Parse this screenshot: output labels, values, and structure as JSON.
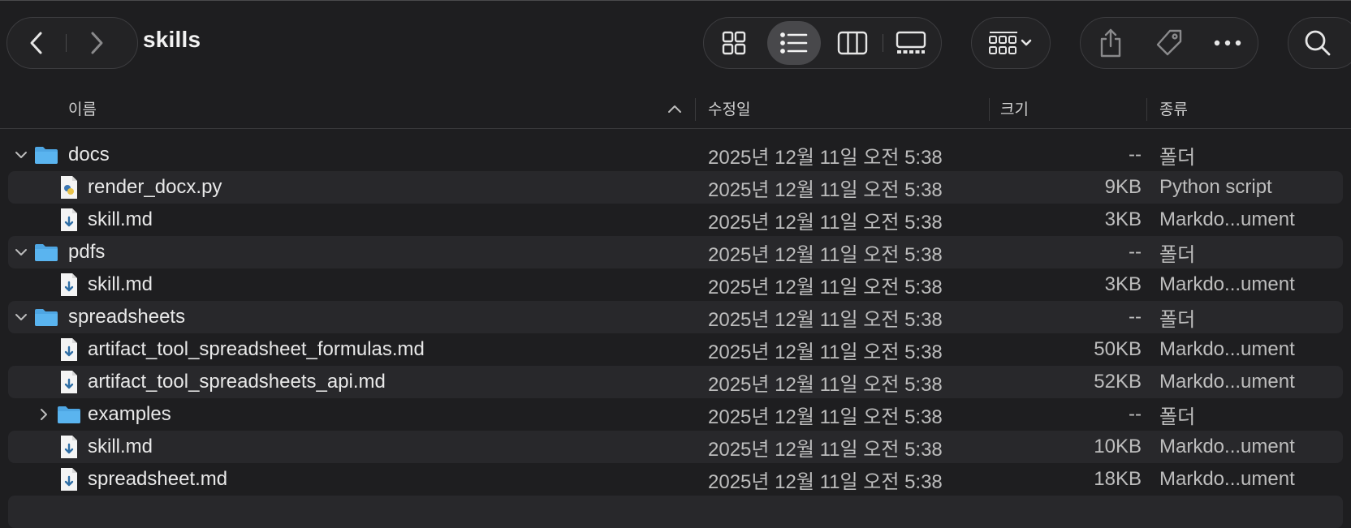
{
  "window": {
    "title": "skills"
  },
  "toolbar": {
    "nav": {
      "back_icon": "chevron-left-icon",
      "forward_icon": "chevron-right-icon"
    },
    "views": [
      {
        "name": "icon-view",
        "icon": "grid-icon",
        "active": false
      },
      {
        "name": "list-view",
        "icon": "list-icon",
        "active": true
      },
      {
        "name": "column-view",
        "icon": "columns-icon",
        "active": false
      },
      {
        "name": "gallery-view",
        "icon": "gallery-icon",
        "active": false
      }
    ],
    "group_icon": "group-by-icon",
    "actions": [
      "share-icon",
      "tag-icon",
      "more-icon"
    ],
    "search_icon": "search-icon"
  },
  "columns": {
    "name": "이름",
    "date": "수정일",
    "size": "크기",
    "kind": "종류"
  },
  "rows": [
    {
      "name": "docs",
      "date": "2025년 12월 11일 오전 5:38",
      "size": "--",
      "kind": "폴더",
      "type": "folder",
      "level": 0,
      "expanded": true
    },
    {
      "name": "render_docx.py",
      "date": "2025년 12월 11일 오전 5:38",
      "size": "9KB",
      "kind": "Python script",
      "type": "python",
      "level": 1
    },
    {
      "name": "skill.md",
      "date": "2025년 12월 11일 오전 5:38",
      "size": "3KB",
      "kind": "Markdo...ument",
      "type": "markdown",
      "level": 1
    },
    {
      "name": "pdfs",
      "date": "2025년 12월 11일 오전 5:38",
      "size": "--",
      "kind": "폴더",
      "type": "folder",
      "level": 0,
      "expanded": true
    },
    {
      "name": "skill.md",
      "date": "2025년 12월 11일 오전 5:38",
      "size": "3KB",
      "kind": "Markdo...ument",
      "type": "markdown",
      "level": 1
    },
    {
      "name": "spreadsheets",
      "date": "2025년 12월 11일 오전 5:38",
      "size": "--",
      "kind": "폴더",
      "type": "folder",
      "level": 0,
      "expanded": true
    },
    {
      "name": "artifact_tool_spreadsheet_formulas.md",
      "date": "2025년 12월 11일 오전 5:38",
      "size": "50KB",
      "kind": "Markdo...ument",
      "type": "markdown",
      "level": 1
    },
    {
      "name": "artifact_tool_spreadsheets_api.md",
      "date": "2025년 12월 11일 오전 5:38",
      "size": "52KB",
      "kind": "Markdo...ument",
      "type": "markdown",
      "level": 1
    },
    {
      "name": "examples",
      "date": "2025년 12월 11일 오전 5:38",
      "size": "--",
      "kind": "폴더",
      "type": "folder",
      "level": 1,
      "expanded": false
    },
    {
      "name": "skill.md",
      "date": "2025년 12월 11일 오전 5:38",
      "size": "10KB",
      "kind": "Markdo...ument",
      "type": "markdown",
      "level": 1
    },
    {
      "name": "spreadsheet.md",
      "date": "2025년 12월 11일 오전 5:38",
      "size": "18KB",
      "kind": "Markdo...ument",
      "type": "markdown",
      "level": 1
    }
  ],
  "colors": {
    "folder": "#5ab4ef",
    "folder_tab": "#4ea6e3",
    "alt_row": "#28282b",
    "background": "#1e1e20"
  }
}
